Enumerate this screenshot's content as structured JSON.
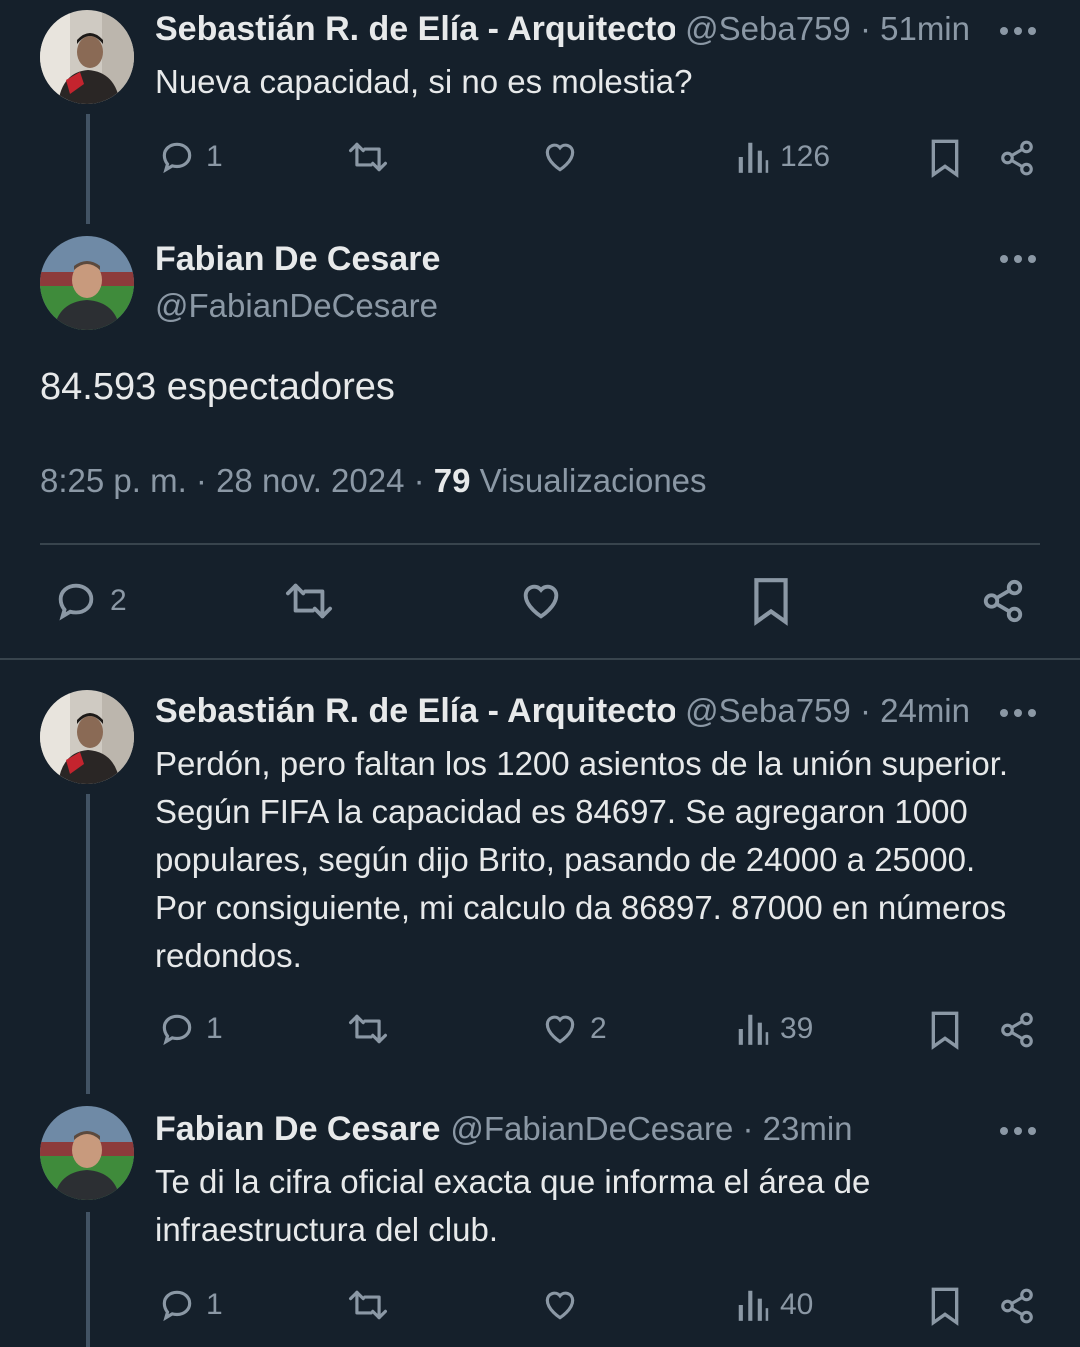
{
  "colors": {
    "background": "#15202b",
    "text": "#e7e9ea",
    "muted": "#8b98a5",
    "divider": "#38444d"
  },
  "tweet1": {
    "name": "Sebastián R. de Elía - Arquitecto",
    "handle_time": "@Seba759 · 51min",
    "text": "Nueva capacidad, si no es molestia?",
    "replies": "1",
    "views": "126"
  },
  "main": {
    "name": "Fabian De Cesare",
    "handle": "@FabianDeCesare",
    "text": "84.593 espectadores",
    "timestamp": "8:25 p. m. · 28 nov. 2024 · ",
    "views_count": "79",
    "views_label": " Visualizaciones",
    "replies": "2"
  },
  "tweet3": {
    "name": "Sebastián R. de Elía - Arquitecto",
    "handle_time": "@Seba759 · 24min",
    "text": "Perdón, pero faltan los 1200 asientos de la unión superior. Según FIFA la capacidad es 84697. Se agregaron 1000 populares, según dijo Brito, pasando de 24000 a 25000. Por consiguiente, mi calculo da 86897. 87000 en números redondos.",
    "replies": "1",
    "likes": "2",
    "views": "39"
  },
  "tweet4": {
    "name": "Fabian De Cesare",
    "handle_time": "@FabianDeCesare · 23min",
    "text": "Te di la cifra oficial exacta que informa el área de infraestructura del club.",
    "replies": "1",
    "views": "40"
  },
  "icons": [
    "reply-icon",
    "retweet-icon",
    "like-icon",
    "views-icon",
    "bookmark-icon",
    "share-icon",
    "more-icon"
  ]
}
